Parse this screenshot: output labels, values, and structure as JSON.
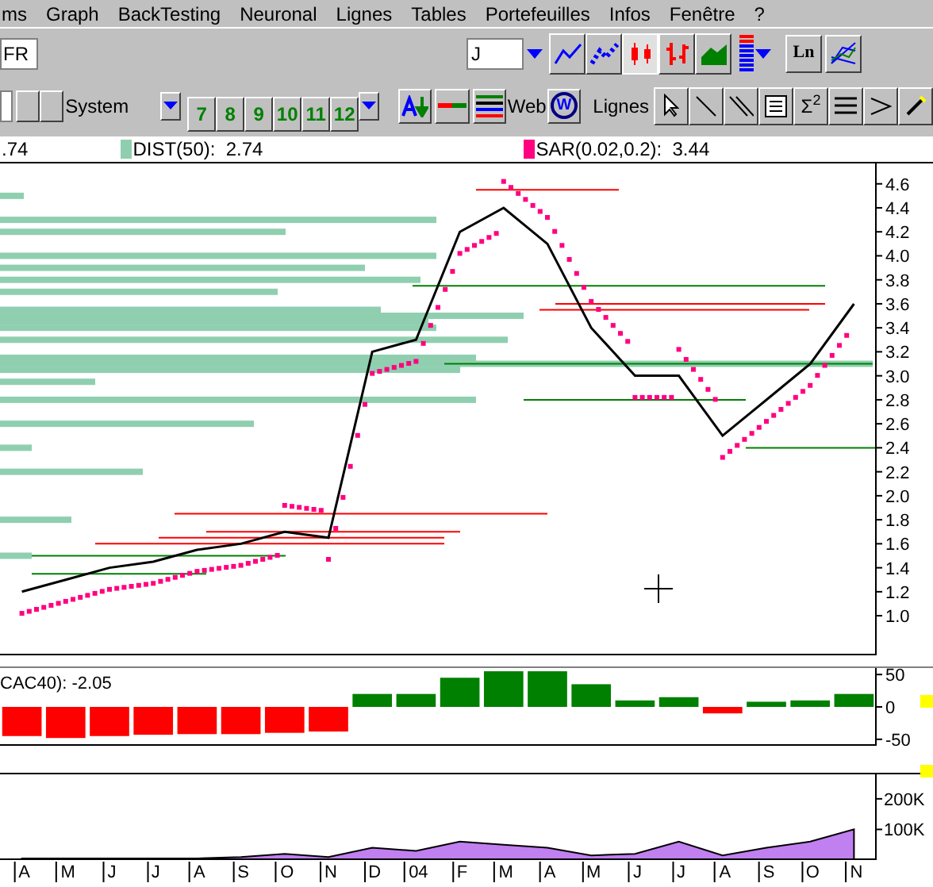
{
  "menu": [
    "ms",
    "Graph",
    "BackTesting",
    "Neuronal",
    "Lignes",
    "Tables",
    "Portefeuilles",
    "Infos",
    "Fenêtre",
    "?"
  ],
  "toolbar_1": {
    "symbol_field": "FR",
    "period_field": "J",
    "log_button": "Ln",
    "chart_types": [
      {
        "kind": "line",
        "selected": false
      },
      {
        "kind": "dotted-line",
        "selected": false
      },
      {
        "kind": "candles",
        "selected": true
      },
      {
        "kind": "bars",
        "selected": false
      },
      {
        "kind": "area",
        "selected": false
      }
    ]
  },
  "toolbar_2": {
    "system_label": "System",
    "day_buttons": [
      "7",
      "8",
      "9",
      "10",
      "11",
      "12"
    ],
    "web_label": "Web",
    "web_button": "W",
    "lines_label": "Lignes",
    "sum_button": "Σ$^{2}$"
  },
  "legend": {
    "left_value": ".74",
    "items": [
      {
        "label": "DIST(50):  2.74",
        "color": "#8fcfb0"
      },
      {
        "label": "SAR(0.02,0.2):  3.44",
        "color": "#ff0080"
      }
    ]
  },
  "price_chart": {
    "chart_data": {
      "type": "line",
      "series": [
        {
          "color": "#000000",
          "values": [
            1.2,
            1.3,
            1.4,
            1.45,
            1.55,
            1.6,
            1.7,
            1.65,
            3.2,
            3.3,
            4.2,
            4.4,
            4.1,
            3.4,
            3.0,
            3.0,
            2.5,
            2.8,
            3.1,
            3.6
          ]
        }
      ],
      "ylim": [
        0.67,
        4.77
      ],
      "yticks": [
        4.6,
        4.4,
        4.2,
        {
          "value": 4,
          "label": "4.0"
        },
        3.8,
        3.6,
        3.4,
        3.2,
        {
          "value": 3,
          "label": "3.0"
        },
        2.8,
        2.6,
        2.4,
        2.2,
        {
          "value": 2,
          "label": "2.0"
        },
        1.8,
        1.6,
        1.4,
        1.2,
        {
          "value": 1,
          "label": "1.0"
        }
      ]
    }
  },
  "oscillator": {
    "legend": "CAC40): -2.05",
    "chart_data": {
      "type": "bar",
      "stacked": true,
      "series": [
        {
          "color": "#008000",
          "values": [
            null,
            null,
            null,
            null,
            null,
            null,
            null,
            null,
            20,
            20,
            45,
            55,
            55,
            35,
            10,
            15,
            null,
            8,
            10,
            20
          ]
        },
        {
          "color": "#ff0000",
          "values": [
            -45,
            -48,
            -45,
            -43,
            -42,
            -42,
            -40,
            -38,
            null,
            null,
            null,
            null,
            null,
            null,
            null,
            null,
            -10,
            null,
            null,
            null
          ]
        }
      ],
      "ylim": [
        -60,
        60
      ],
      "yticks": [
        50,
        0,
        -50
      ]
    }
  },
  "volume": {
    "chart_data": {
      "type": "area",
      "categories": [
        "A",
        "M",
        "J",
        "J",
        "A",
        "S",
        "O",
        "N",
        "D",
        "04",
        "F",
        "M",
        "A",
        "M",
        "J",
        "J",
        "A",
        "S",
        "O",
        "N"
      ],
      "series": [
        {
          "color": "#c080f0",
          "values": [
            5000,
            5000,
            5000,
            5000,
            5000,
            10000,
            20000,
            10000,
            40000,
            30000,
            60000,
            50000,
            40000,
            15000,
            20000,
            60000,
            15000,
            40000,
            60000,
            100000
          ]
        }
      ],
      "ylim": [
        0,
        280000
      ],
      "yticks": [
        {
          "value": 200000,
          "label": "200K"
        },
        {
          "value": 100000,
          "label": "100K"
        }
      ]
    }
  }
}
